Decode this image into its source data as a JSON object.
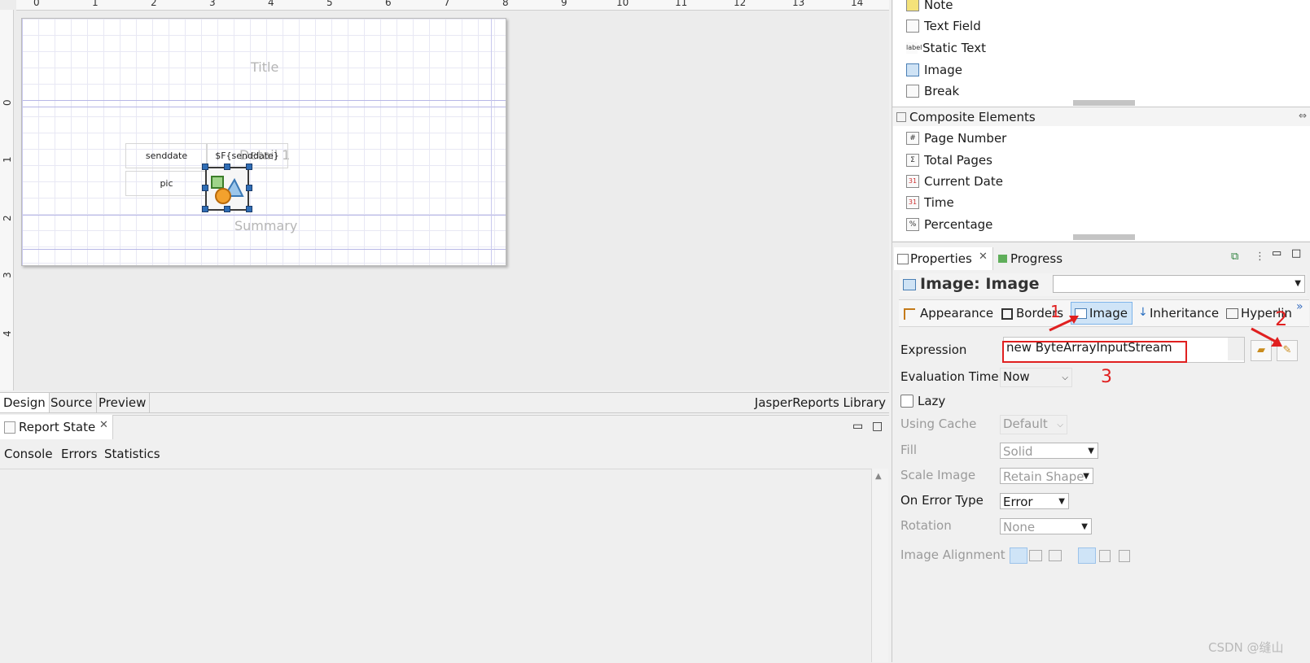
{
  "design": {
    "ruler_marks": [
      "0",
      "1",
      "2",
      "3",
      "4",
      "5",
      "6",
      "7",
      "8",
      "9",
      "10",
      "11",
      "12",
      "13",
      "14"
    ],
    "left_ruler_marks": [
      "0",
      "1",
      "2",
      "3",
      "4"
    ],
    "bands": {
      "title": "Title",
      "detail": "Detail 1",
      "summary": "Summary"
    },
    "fields": {
      "senddate_label": "senddate",
      "senddate_value": "$F{senddate}",
      "pic_label": "pic"
    }
  },
  "editor_tabs": [
    "Design",
    "Source",
    "Preview"
  ],
  "library_label": "JasperReports Library",
  "report_state": {
    "title": "Report State",
    "subtabs": [
      "Console",
      "Errors",
      "Statistics"
    ]
  },
  "palette": {
    "basic_items": [
      {
        "label": "Note",
        "icon": "note-icon"
      },
      {
        "label": "Text Field",
        "icon": "text-field-icon"
      },
      {
        "label": "Static Text",
        "icon": "static-text-icon"
      },
      {
        "label": "Image",
        "icon": "image-icon"
      },
      {
        "label": "Break",
        "icon": "break-icon"
      }
    ],
    "composite_header": "Composite Elements",
    "composite_items": [
      {
        "label": "Page Number",
        "icon": "page-number-icon",
        "glyph": "#"
      },
      {
        "label": "Total Pages",
        "icon": "total-pages-icon",
        "glyph": "Σ"
      },
      {
        "label": "Current Date",
        "icon": "current-date-icon",
        "glyph": "31"
      },
      {
        "label": "Time",
        "icon": "time-icon",
        "glyph": "31"
      },
      {
        "label": "Percentage",
        "icon": "percentage-icon",
        "glyph": "%"
      }
    ]
  },
  "properties": {
    "tab_title": "Properties",
    "progress_title": "Progress",
    "element_title": "Image: Image",
    "section_tabs": [
      "Appearance",
      "Borders",
      "Image",
      "Inheritance",
      "Hyperlin"
    ],
    "expression_label": "Expression",
    "expression_value": "new ByteArrayInputStream",
    "evaluation_time_label": "Evaluation Time",
    "evaluation_time_value": "Now",
    "lazy_label": "Lazy",
    "using_cache_label": "Using Cache",
    "using_cache_value": "Default",
    "fill_label": "Fill",
    "fill_value": "Solid",
    "scale_image_label": "Scale Image",
    "scale_image_value": "Retain Shape",
    "on_error_type_label": "On Error Type",
    "on_error_type_value": "Error",
    "rotation_label": "Rotation",
    "rotation_value": "None",
    "image_alignment_label": "Image Alignment"
  },
  "annotations": {
    "one": "1",
    "two": "2",
    "three": "3"
  },
  "watermark": "CSDN @缝山",
  "colors": {
    "annotation_red": "#e02020",
    "selection_blue": "#2f6db5"
  }
}
